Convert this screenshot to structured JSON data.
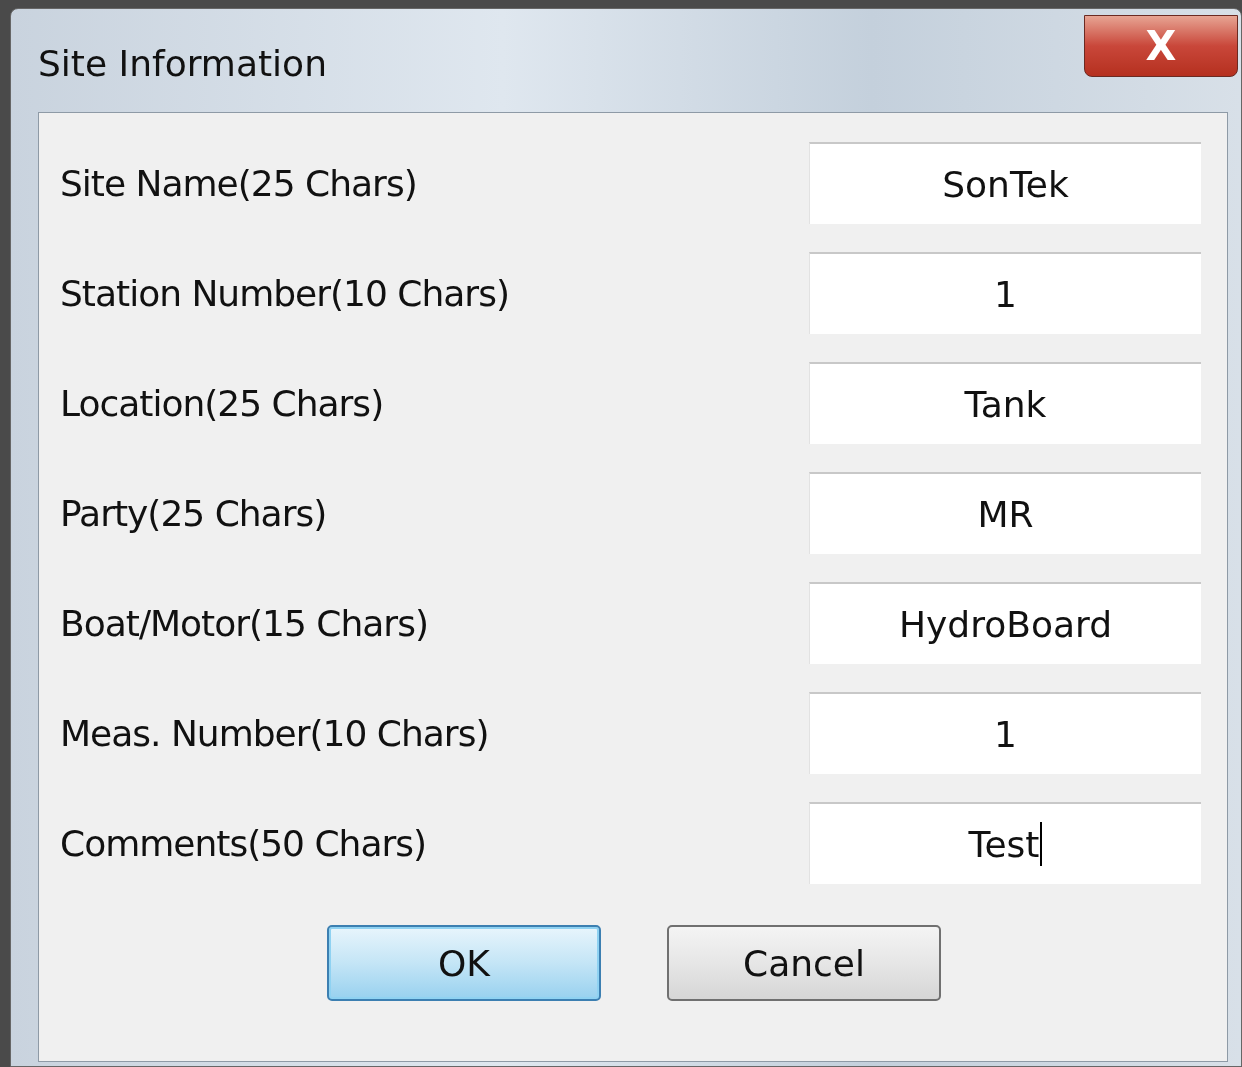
{
  "window": {
    "title": "Site Information",
    "close_label": "X"
  },
  "fields": [
    {
      "label": "Site Name(25 Chars)",
      "value": "SonTek",
      "focused": false
    },
    {
      "label": "Station Number(10 Chars)",
      "value": "1",
      "focused": false
    },
    {
      "label": "Location(25 Chars)",
      "value": "Tank",
      "focused": false
    },
    {
      "label": "Party(25 Chars)",
      "value": "MR",
      "focused": false
    },
    {
      "label": "Boat/Motor(15 Chars)",
      "value": "HydroBoard",
      "focused": false
    },
    {
      "label": "Meas. Number(10 Chars)",
      "value": "1",
      "focused": false
    },
    {
      "label": "Comments(50 Chars)",
      "value": "Test",
      "focused": true
    }
  ],
  "buttons": [
    {
      "label": "OK",
      "default": true
    },
    {
      "label": "Cancel",
      "default": false
    }
  ]
}
